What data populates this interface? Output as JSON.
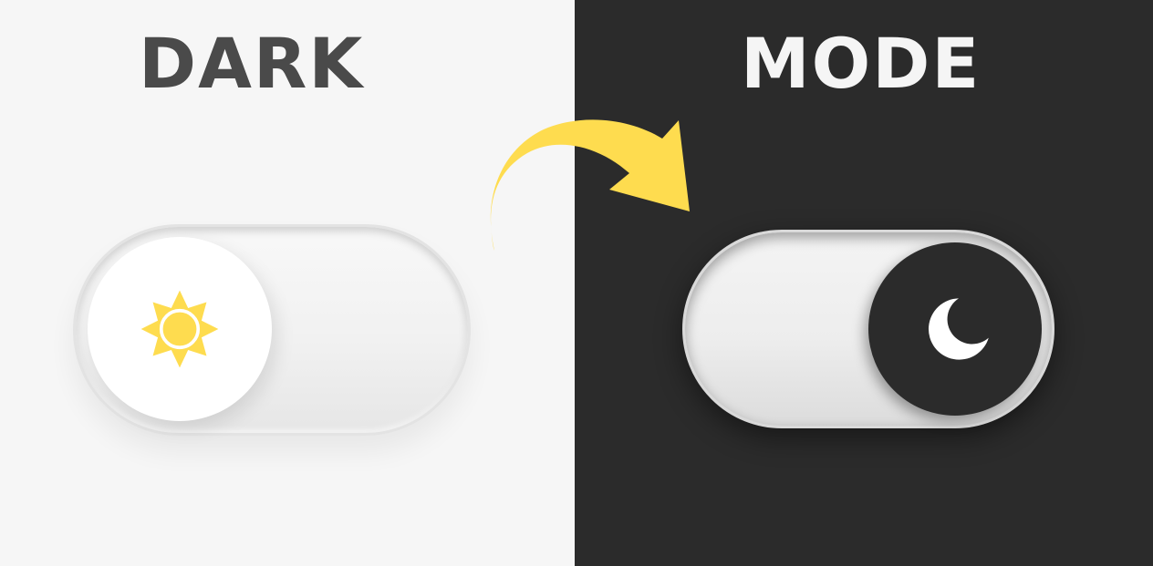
{
  "headline": {
    "left_word": "DARK",
    "right_word": "MODE"
  },
  "toggle_light": {
    "state": "off",
    "icon": "sun-icon"
  },
  "toggle_dark": {
    "state": "on",
    "icon": "moon-icon"
  },
  "colors": {
    "light_background": "#f6f6f6",
    "dark_background": "#2b2b2b",
    "accent_yellow": "#fedc4f",
    "headline_dark": "#4a4a4a",
    "headline_light": "#f5f5f5"
  }
}
